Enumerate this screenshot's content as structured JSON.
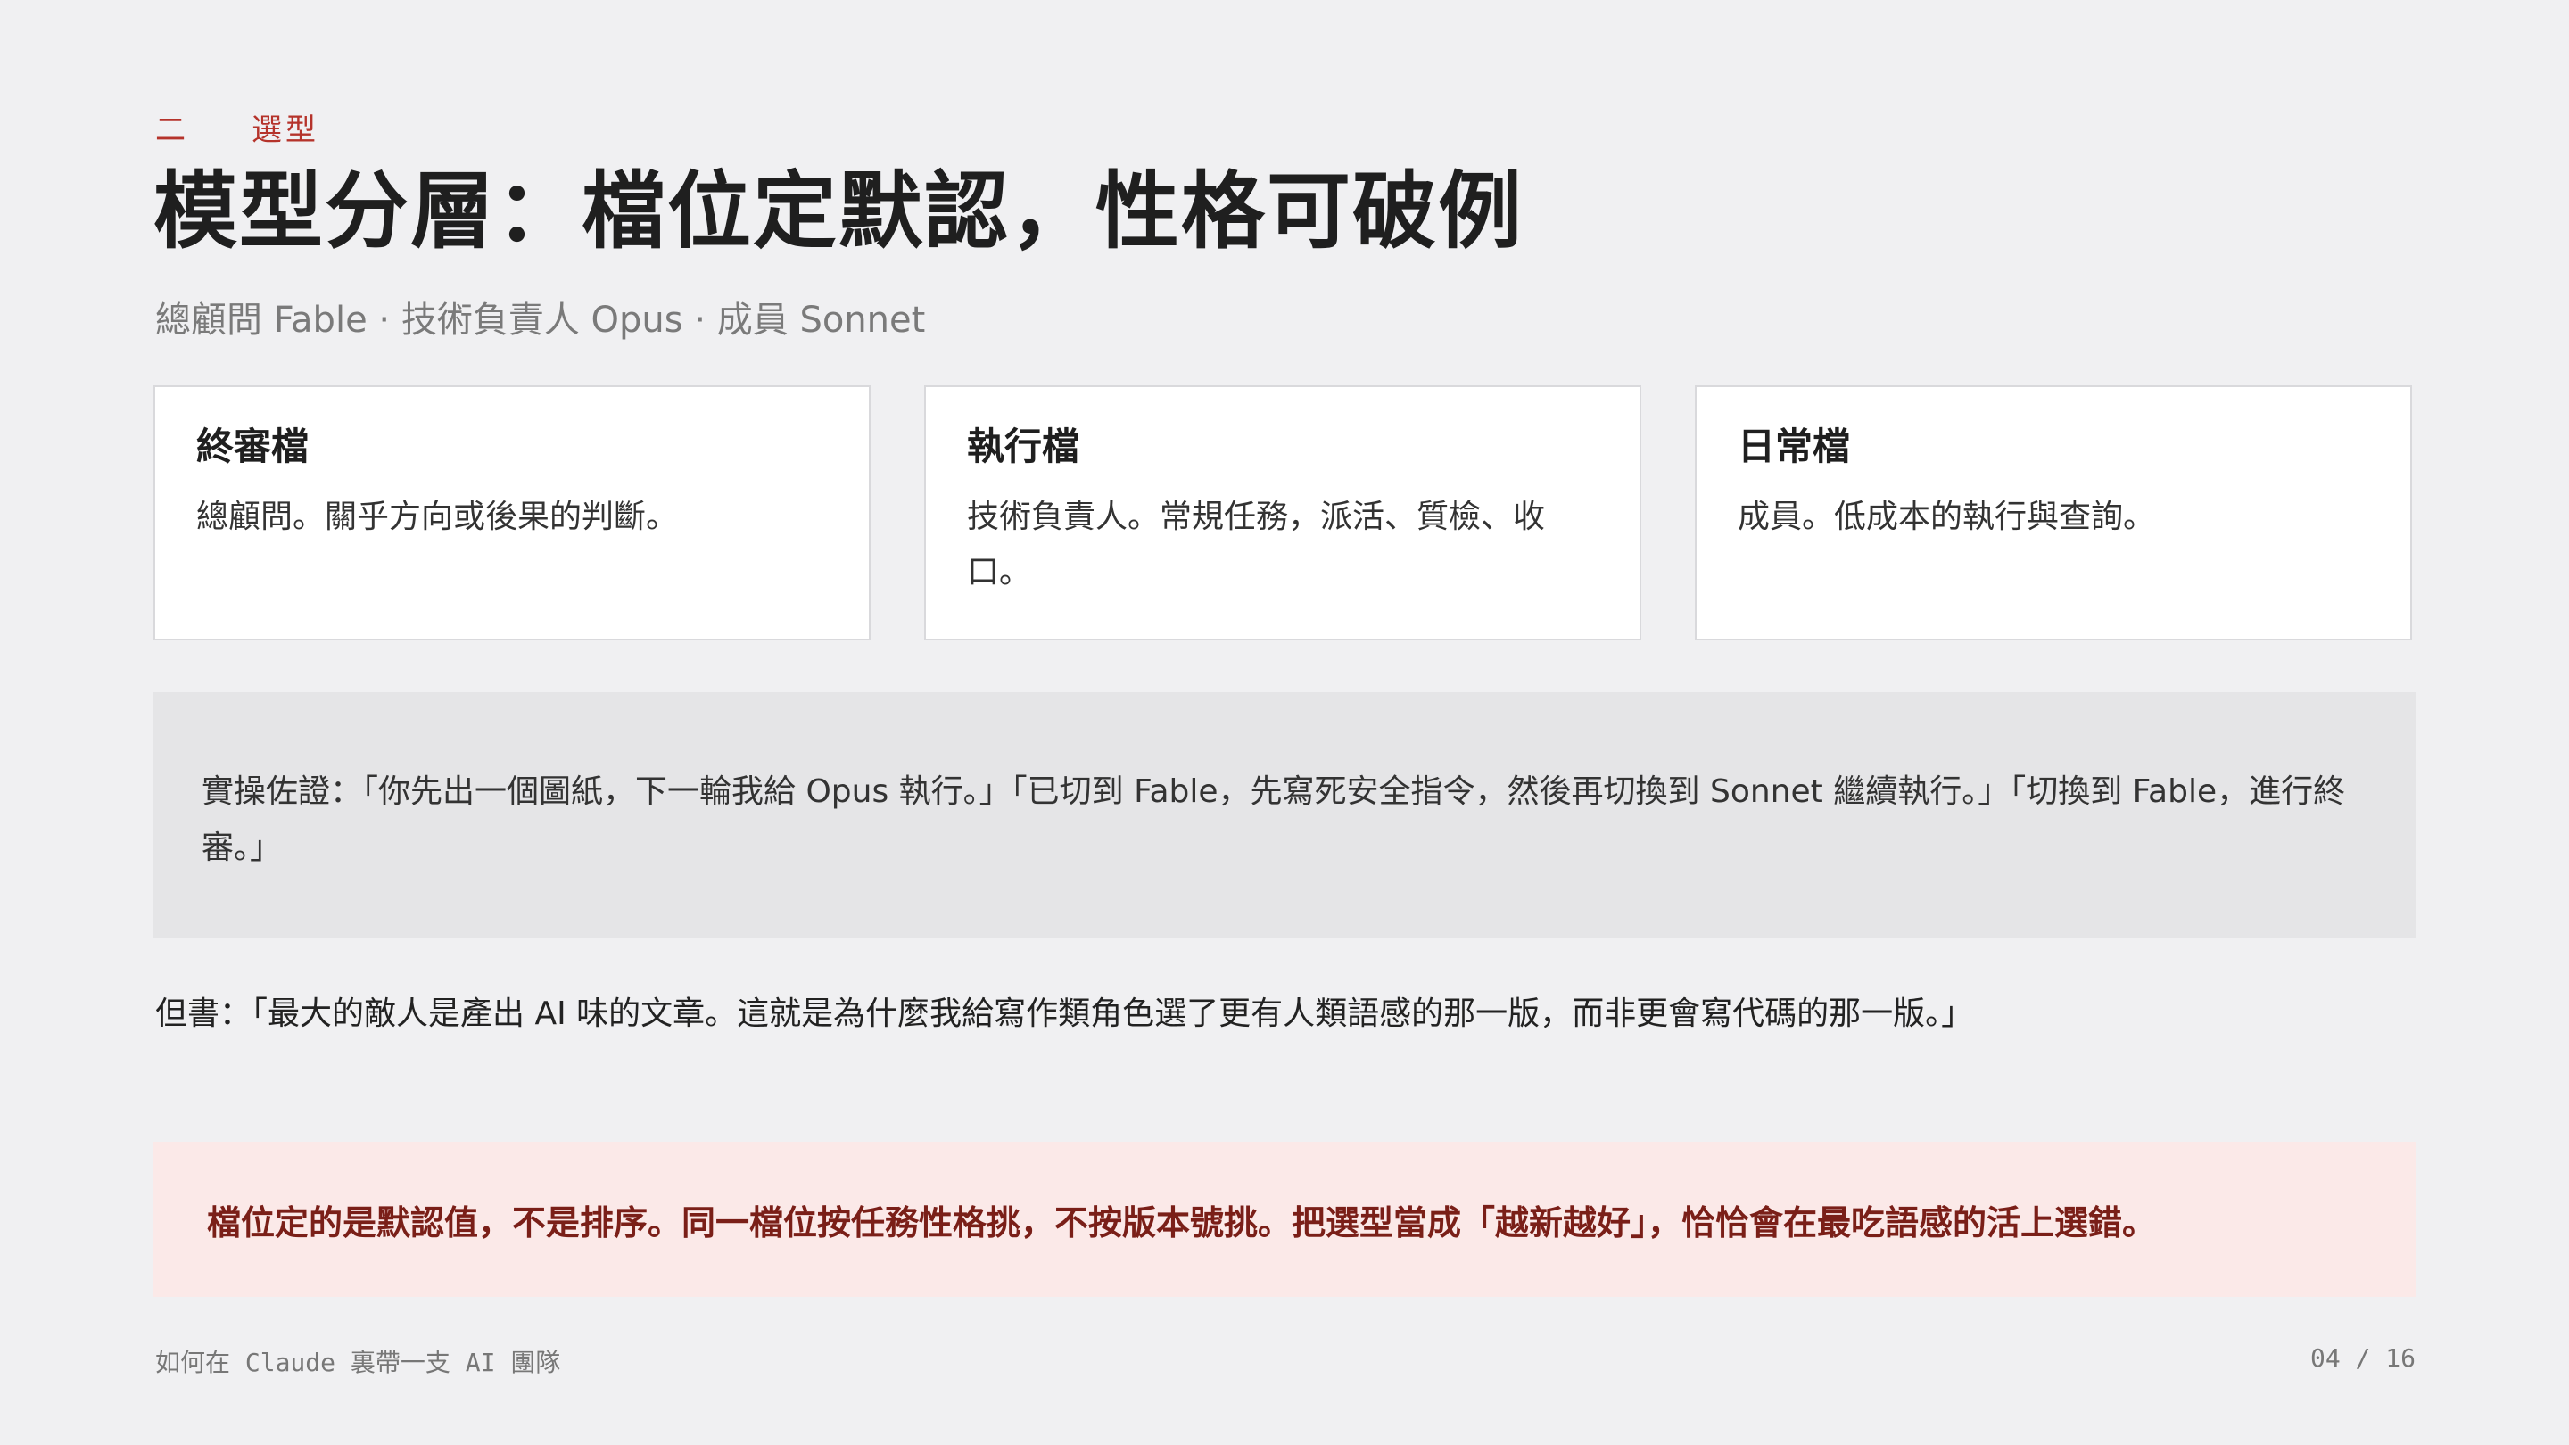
{
  "section": {
    "number": "二",
    "label": "選型"
  },
  "title": "模型分層：檔位定默認，性格可破例",
  "subtitle": "總顧問 Fable · 技術負責人 Opus · 成員 Sonnet",
  "cards": [
    {
      "title": "終審檔",
      "body": "總顧問。關乎方向或後果的判斷。"
    },
    {
      "title": "執行檔",
      "body": "技術負責人。常規任務，派活、質檢、收口。"
    },
    {
      "title": "日常檔",
      "body": "成員。低成本的執行與查詢。"
    }
  ],
  "evidence": "實操佐證：「你先出一個圖紙，下一輪我給 Opus 執行。」「已切到 Fable，先寫死安全指令，然後再切換到 Sonnet 繼續執行。」「切換到 Fable，進行終審。」",
  "quote": "但書：「最大的敵人是產出 AI 味的文章。這就是為什麼我給寫作類角色選了更有人類語感的那一版，而非更會寫代碼的那一版。」",
  "callout": "檔位定的是默認值，不是排序。同一檔位按任務性格挑，不按版本號挑。把選型當成「越新越好」，恰恰會在最吃語感的活上選錯。",
  "footer": {
    "deck_title": "如何在 Claude 裏帶一支 AI 團隊",
    "page": "04 / 16"
  }
}
